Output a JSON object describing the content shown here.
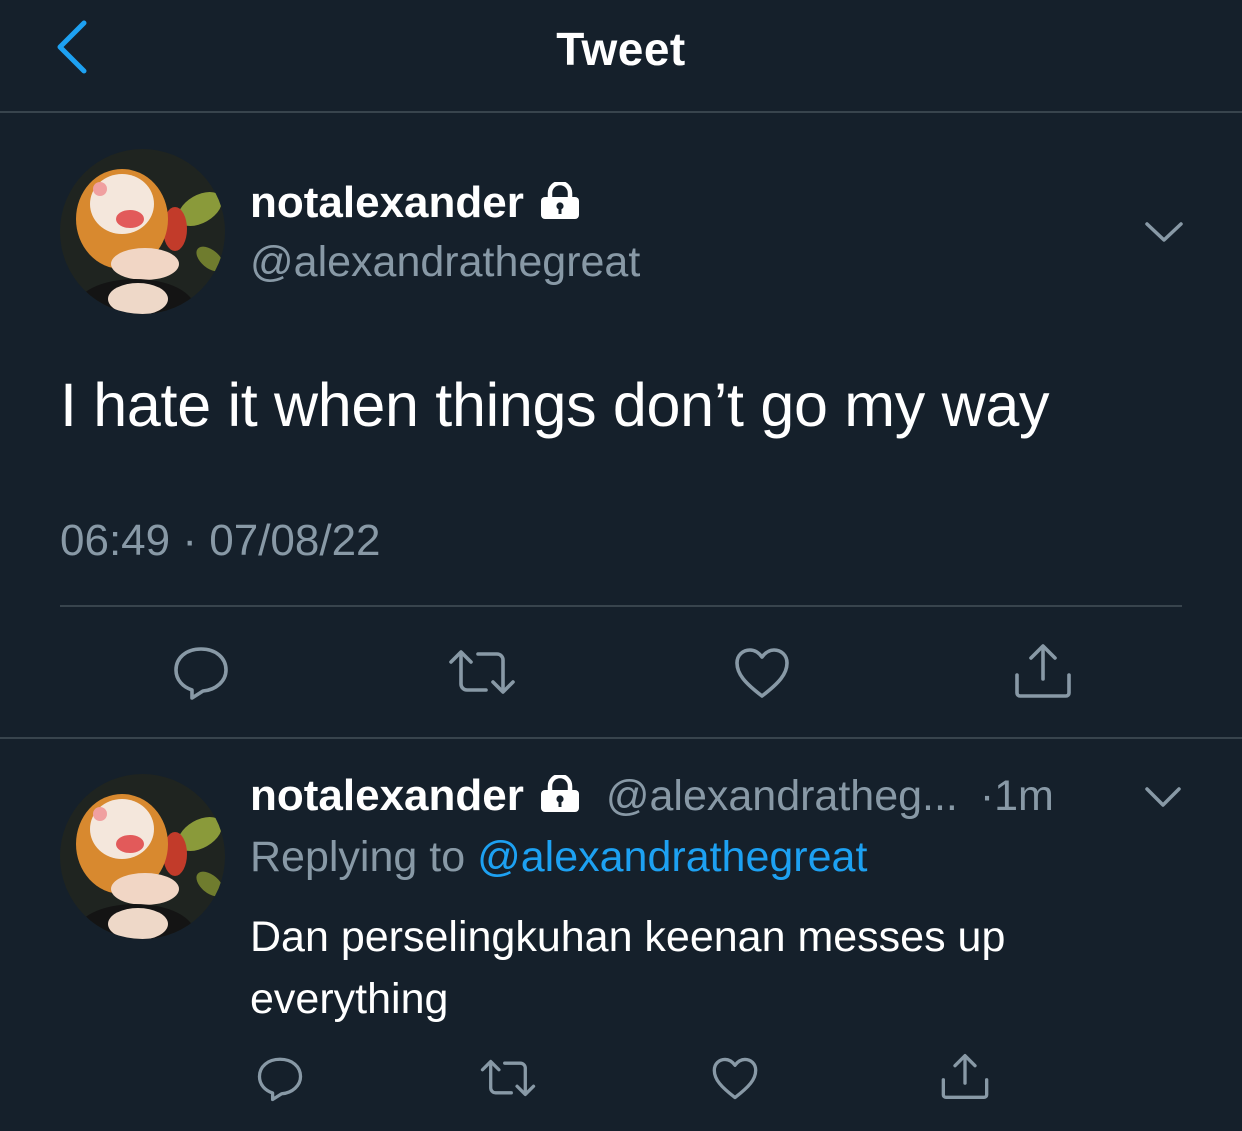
{
  "header": {
    "title": "Tweet",
    "back_icon": "chevron-left-icon"
  },
  "main_tweet": {
    "display_name": "notalexander",
    "handle": "@alexandrathegreat",
    "text": "I hate it when things don’t go my way",
    "time": "06:49",
    "separator": "·",
    "date": "07/08/22",
    "icons": [
      "lock-icon",
      "chevron-down-icon",
      "reply-icon",
      "retweet-icon",
      "like-icon",
      "share-icon"
    ]
  },
  "reply_tweet": {
    "display_name": "notalexander",
    "handle": "@alexandratheg...",
    "time": "·1m",
    "replying_label": "Replying to",
    "replying_to": "@alexandrathegreat",
    "text": "Dan perselingkuhan keenan messes up everything"
  },
  "colors": {
    "background": "#15202b",
    "divider": "#38444d",
    "secondary_text": "#8899a6",
    "accent": "#1da1f2",
    "primary_text": "#ffffff"
  }
}
